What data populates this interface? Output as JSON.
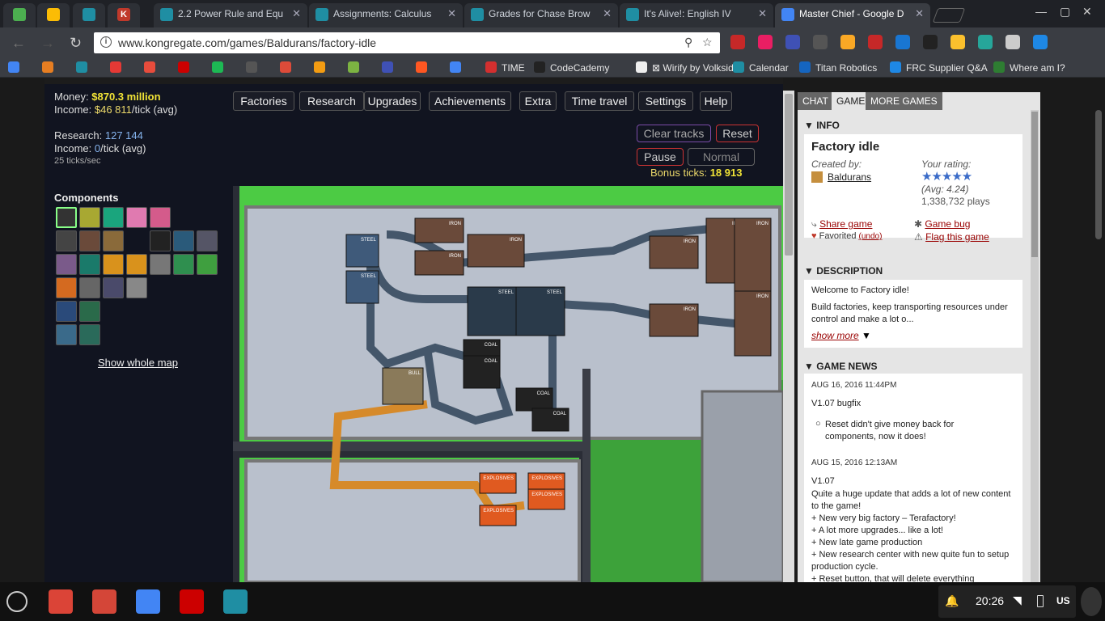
{
  "tabs": [
    {
      "label": "",
      "color": "#4caf50",
      "mini": true
    },
    {
      "label": "",
      "color": "#fbbc05",
      "mini": true
    },
    {
      "label": "",
      "color": "#1f8ea3",
      "mini": true
    },
    {
      "label": "K",
      "color": "#c0392b",
      "mini": true
    },
    {
      "label": "2.2 Power Rule and Equ",
      "color": "#1f8ea3"
    },
    {
      "label": "Assignments: Calculus",
      "color": "#1f8ea3"
    },
    {
      "label": "Grades for Chase Brow",
      "color": "#1f8ea3"
    },
    {
      "label": "It's Alive!: English IV",
      "color": "#1f8ea3"
    },
    {
      "label": "Master Chief - Google D",
      "color": "#4285f4"
    }
  ],
  "window_controls": {
    "minimize": "—",
    "maximize": "▢",
    "close": "✕"
  },
  "address": {
    "url": "www.kongregate.com/games/Baldurans/factory-idle",
    "info": "i",
    "key_icon": "⚲",
    "star": "☆"
  },
  "bookmarks": [
    {
      "label": "",
      "color": "#4285f4"
    },
    {
      "label": "",
      "color": "#e67e22"
    },
    {
      "label": "",
      "color": "#1f8ea3"
    },
    {
      "label": "",
      "color": "#e53935"
    },
    {
      "label": "",
      "color": "#e74c3c"
    },
    {
      "label": "",
      "color": "#cc0000"
    },
    {
      "label": "",
      "color": "#1db954"
    },
    {
      "label": "",
      "color": "#555555"
    },
    {
      "label": "",
      "color": "#dd4b39"
    },
    {
      "label": "",
      "color": "#f39c12"
    },
    {
      "label": "",
      "color": "#7cb342"
    },
    {
      "label": "",
      "color": "#3f51b5"
    },
    {
      "label": "",
      "color": "#ff5722"
    },
    {
      "label": "",
      "color": "#4285f4"
    },
    {
      "label": "TIME",
      "color": "#d32f2f"
    },
    {
      "label": "CodeCademy",
      "color": "#222222"
    },
    {
      "label": "⊠ Wirify by Volkside",
      "color": "#eeeeee"
    },
    {
      "label": "Calendar",
      "color": "#1f8ea3"
    },
    {
      "label": "Titan Robotics",
      "color": "#1565c0"
    },
    {
      "label": "FRC Supplier Q&A",
      "color": "#1e88e5"
    },
    {
      "label": "Where am I?",
      "color": "#2e7d32"
    }
  ],
  "stats": {
    "money_label": "Money: ",
    "money_currency": "$",
    "money": "870.3 million",
    "income_label": "Income: ",
    "income_currency": "$",
    "income": "46 811",
    "income_suffix": "/tick (avg)",
    "research_label": "Research: ",
    "research": "127 144",
    "research_income_label": "Income: ",
    "research_income": "0",
    "research_income_suffix": "/tick (avg)",
    "ticks": "25 ticks/sec"
  },
  "menu": [
    "Factories",
    "Research",
    "Upgrades",
    "Achievements",
    "Extra",
    "Time travel",
    "Settings",
    "Help"
  ],
  "controls": {
    "clear_tracks": "Clear tracks",
    "reset": "Reset",
    "pause": "Pause",
    "normal": "Normal",
    "bonus_label": "Bonus ticks: ",
    "bonus_value": "18 913"
  },
  "components": {
    "title": "Components",
    "show_map": "Show whole map"
  },
  "map_labels": [
    "IRON",
    "STEEL",
    "COAL",
    "BULL",
    "EXPLOSIVES"
  ],
  "side": {
    "tabs": [
      "CHAT",
      "GAME",
      "MORE GAMES"
    ],
    "info_header": "INFO",
    "game_title": "Factory idle",
    "created_by": "Created by:",
    "author": "Baldurans",
    "your_rating": "Your rating:",
    "stars": "★★★★★",
    "avg": "(Avg: 4.24)",
    "plays": "1,338,732 plays",
    "share": "Share game",
    "game_bug": "Game bug",
    "favorited": "Favorited",
    "undo": "(undo)",
    "flag": "Flag this game",
    "desc_header": "DESCRIPTION",
    "welcome": "Welcome to Factory idle!",
    "desc": "Build factories, keep transporting resources under control and make a lot o...",
    "show_more": "show more",
    "news_header": "GAME NEWS",
    "news1_date": "AUG 16, 2016 11:44PM",
    "news1_title": "V1.07 bugfix",
    "news1_item": "Reset didn't give money back for components, now it does!",
    "news2_date": "AUG 15, 2016 12:13AM",
    "news2_title": "V1.07",
    "news2_l1": "Quite a huge update that adds a lot of new content to the game!",
    "news2_l2": "+ New very big factory – Terafactory!",
    "news2_l3": "+ A lot more upgrades... like a lot!",
    "news2_l4": "+ New late game production",
    "news2_l5": "+ New research center with new quite fun to setup production cycle.",
    "news2_l6": "+ Reset button, that will delete everything"
  },
  "taskbar": {
    "dock": [
      {
        "name": "chrome",
        "color": "#db4437"
      },
      {
        "name": "gmail",
        "color": "#d44638"
      },
      {
        "name": "docs",
        "color": "#4285f4"
      },
      {
        "name": "youtube",
        "color": "#cc0000"
      },
      {
        "name": "app",
        "color": "#1f8ea3"
      }
    ],
    "time": "20:26",
    "locale": "US"
  }
}
